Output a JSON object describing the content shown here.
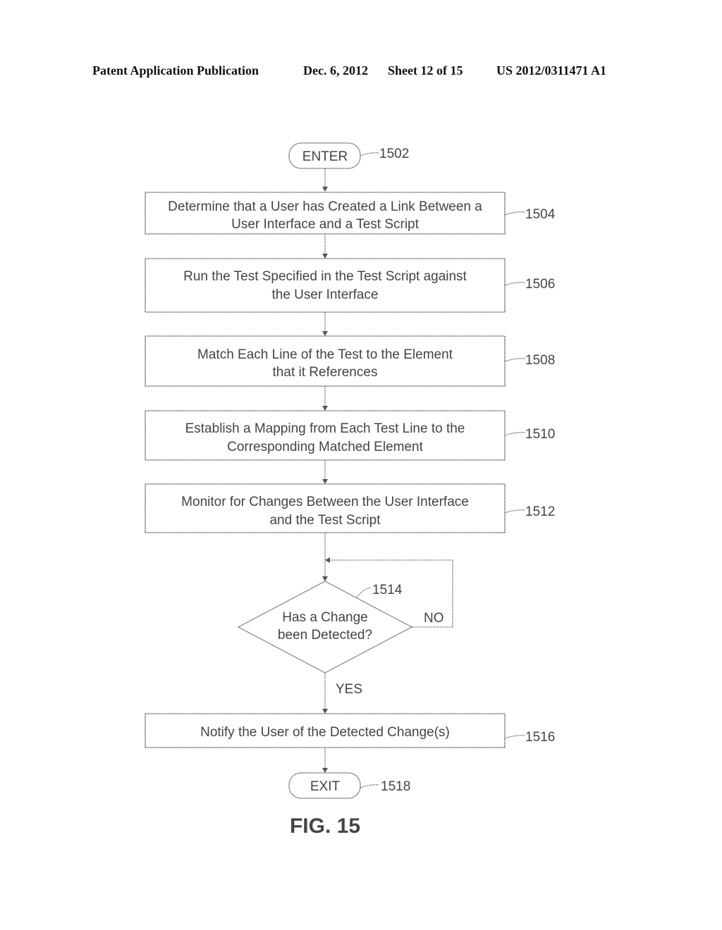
{
  "header": {
    "publication": "Patent Application Publication",
    "date": "Dec. 6, 2012",
    "sheet": "Sheet 12 of 15",
    "number": "US 2012/0311471 A1"
  },
  "figure_label": "FIG. 15",
  "flowchart": {
    "start": {
      "label": "ENTER",
      "ref": "1502"
    },
    "steps": [
      {
        "ref": "1504",
        "lines": [
          "Determine that a User has Created a Link Between a",
          "User Interface and a Test Script"
        ]
      },
      {
        "ref": "1506",
        "lines": [
          "Run the Test Specified in the Test Script against",
          "the User Interface"
        ]
      },
      {
        "ref": "1508",
        "lines": [
          "Match Each Line of the Test to the Element",
          "that it References"
        ]
      },
      {
        "ref": "1510",
        "lines": [
          "Establish a Mapping from Each Test Line to the",
          "Corresponding Matched Element"
        ]
      },
      {
        "ref": "1512",
        "lines": [
          "Monitor for Changes Between the User Interface",
          "and the Test Script"
        ]
      }
    ],
    "decision": {
      "ref": "1514",
      "lines": [
        "Has a Change",
        "been Detected?"
      ],
      "no_label": "NO",
      "yes_label": "YES"
    },
    "final_step": {
      "ref": "1516",
      "lines": [
        "Notify the User of the Detected Change(s)"
      ]
    },
    "end": {
      "label": "EXIT",
      "ref": "1518"
    }
  }
}
